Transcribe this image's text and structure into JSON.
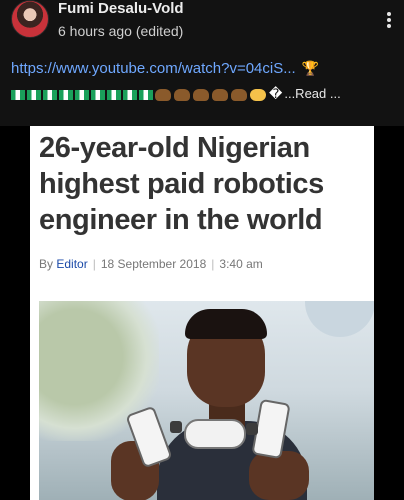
{
  "post": {
    "author": "Fumi Desalu-Vold",
    "time": "6 hours ago (edited)",
    "link_text": "https://www.youtube.com/watch?v=04ciS...",
    "trophy_emoji": "🏆",
    "replacement_char": "�",
    "read_more": "...Read ..."
  },
  "article": {
    "headline": "26-year-old Nigerian highest paid robotics engineer in the world",
    "by_prefix": "By",
    "author": "Editor",
    "date": "18 September 2018",
    "time": "3:40 am"
  },
  "colors": {
    "background": "#121212",
    "link": "#6fa8ff",
    "headline": "#333333",
    "byline_author": "#1b4aa8"
  }
}
